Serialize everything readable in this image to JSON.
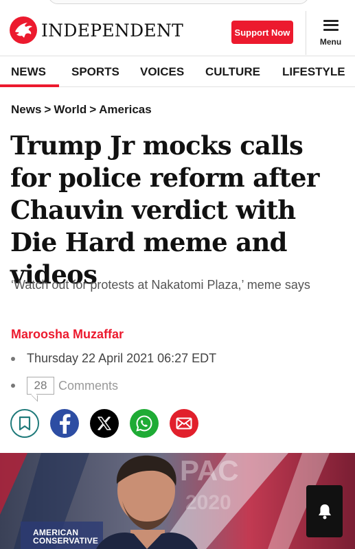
{
  "header": {
    "brand": "INDEPENDENT",
    "support_label": "Support Now",
    "menu_label": "Menu",
    "brand_color": "#ec1a2e"
  },
  "nav": {
    "items": [
      {
        "label": "NEWS",
        "active": true
      },
      {
        "label": "SPORTS",
        "active": false
      },
      {
        "label": "VOICES",
        "active": false
      },
      {
        "label": "CULTURE",
        "active": false
      },
      {
        "label": "LIFESTYLE",
        "active": false
      }
    ]
  },
  "breadcrumb": [
    "News",
    "World",
    "Americas"
  ],
  "breadcrumb_separator": ">",
  "article": {
    "headline": "Trump Jr mocks calls for police reform after Chauvin verdict with Die Hard meme and videos",
    "standfirst": "‘Watch out for protests at Nakatomi Plaza,’ meme says",
    "author": "Maroosha Muzaffar",
    "date": "Thursday 22 April 2021 06:27 EDT",
    "comment_count": "28",
    "comments_label": "Comments"
  },
  "share": [
    {
      "name": "bookmark-icon",
      "color": "#1f7a7a"
    },
    {
      "name": "facebook-icon",
      "color": "#2d4da3"
    },
    {
      "name": "x-icon",
      "color": "#000000"
    },
    {
      "name": "whatsapp-icon",
      "color": "#1fab35"
    },
    {
      "name": "email-icon",
      "color": "#e1202c"
    }
  ],
  "hero": {
    "caption_line1": "AMERICAN",
    "caption_line2": "CONSERVATIVE"
  },
  "notification": {
    "icon": "bell-icon"
  }
}
